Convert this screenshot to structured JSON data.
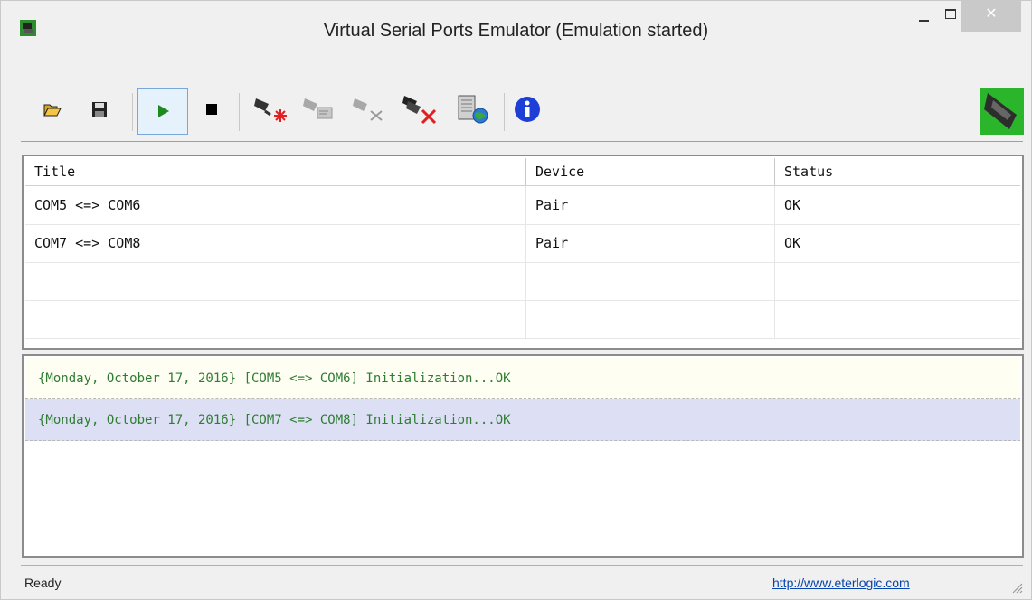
{
  "window": {
    "title": "Virtual Serial Ports Emulator (Emulation started)",
    "close_glyph": "✕"
  },
  "toolbar": {
    "buttons": [
      {
        "name": "open",
        "icon": "folder-open-icon"
      },
      {
        "name": "save",
        "icon": "floppy-disk-icon"
      },
      {
        "name": "start",
        "icon": "play-icon",
        "pressed": true
      },
      {
        "name": "stop",
        "icon": "stop-icon"
      },
      {
        "name": "create-device",
        "icon": "new-device-icon"
      },
      {
        "name": "edit-device",
        "icon": "edit-device-icon"
      },
      {
        "name": "delete-device",
        "icon": "remove-device-icon"
      },
      {
        "name": "delete-all-devices",
        "icon": "remove-all-devices-icon"
      },
      {
        "name": "web",
        "icon": "web-device-icon"
      },
      {
        "name": "about",
        "icon": "info-icon"
      }
    ],
    "logo_icon": "serial-port-logo-icon"
  },
  "ports": {
    "columns": [
      "Title",
      "Device",
      "Status"
    ],
    "rows": [
      {
        "title": "COM5 <=> COM6",
        "device": "Pair",
        "status": "OK"
      },
      {
        "title": "COM7 <=> COM8",
        "device": "Pair",
        "status": "OK"
      }
    ]
  },
  "log": {
    "entries": [
      "{Monday, October 17, 2016} [COM5 <=> COM6] Initialization...OK",
      "{Monday, October 17, 2016} [COM7 <=> COM8] Initialization...OK"
    ],
    "text_color": "#2e7d32"
  },
  "statusbar": {
    "status": "Ready",
    "link": "http://www.eterlogic.com"
  },
  "colors": {
    "close_button": "#c9c9c9",
    "pressed_button_border": "#7aa7d9",
    "log_row_alt": "#dde0f5"
  }
}
